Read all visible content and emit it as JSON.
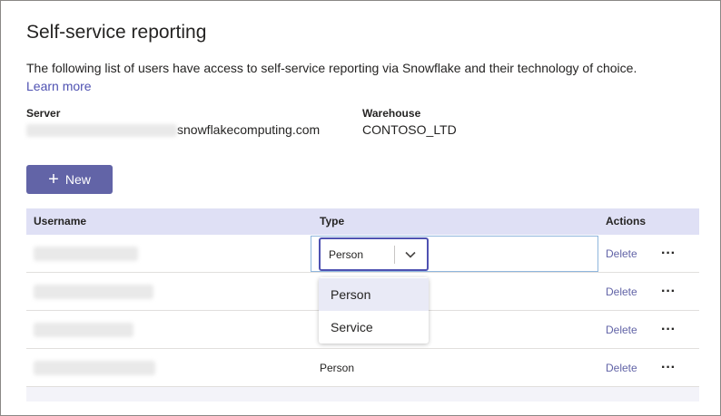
{
  "page": {
    "title": "Self-service reporting",
    "description": "The following list of users have access to self-service reporting via Snowflake and their technology of choice.",
    "learn_more": "Learn more"
  },
  "connection": {
    "server_label": "Server",
    "server_value": "snowflakecomputing.com",
    "warehouse_label": "Warehouse",
    "warehouse_value": "CONTOSO_LTD"
  },
  "toolbar": {
    "new_label": "New"
  },
  "table": {
    "columns": {
      "username": "Username",
      "type": "Type",
      "actions": "Actions"
    },
    "rows": [
      {
        "type": "Person",
        "action": "Delete"
      },
      {
        "type": "",
        "action": "Delete"
      },
      {
        "type": "",
        "action": "Delete"
      },
      {
        "type": "Person",
        "action": "Delete"
      }
    ]
  },
  "dropdown": {
    "selected": "Person",
    "options": [
      "Person",
      "Service"
    ]
  },
  "icons": {
    "new": "plus-icon",
    "dropdown": "chevron-down-icon",
    "more": "more-options-icon"
  },
  "colors": {
    "accent": "#6264a7",
    "header_bg": "#dfe0f5",
    "focus": "#4f52b2"
  }
}
